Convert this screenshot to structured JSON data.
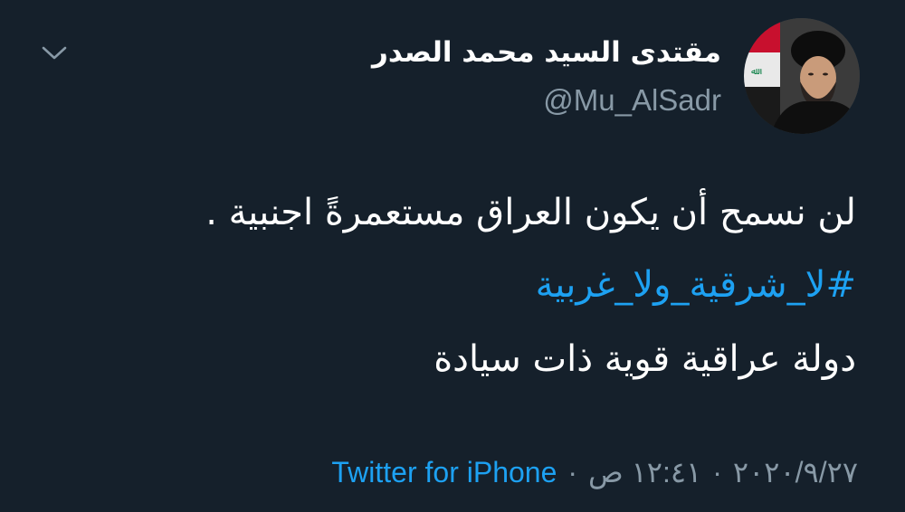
{
  "tweet": {
    "display_name": "مقتدى السيد محمد الصدر",
    "handle": "@Mu_AlSadr",
    "body_line_1": "لن نسمح أن يكون العراق مستعمرةً اجنبية .",
    "hashtag": "#لا_شرقية_ولا_غربية",
    "body_line_3": "دولة عراقية قوية ذات سيادة",
    "source": "Twitter for iPhone",
    "separator": "·",
    "time": "١٢:٤١ ص",
    "date": "٢٠٢٠/٩/٢٧"
  },
  "icons": {
    "menu": "chevron-down-icon",
    "avatar": "profile-photo"
  },
  "colors": {
    "background": "#15202b",
    "text": "#ffffff",
    "secondary": "#8899a6",
    "link": "#1da1f2"
  }
}
